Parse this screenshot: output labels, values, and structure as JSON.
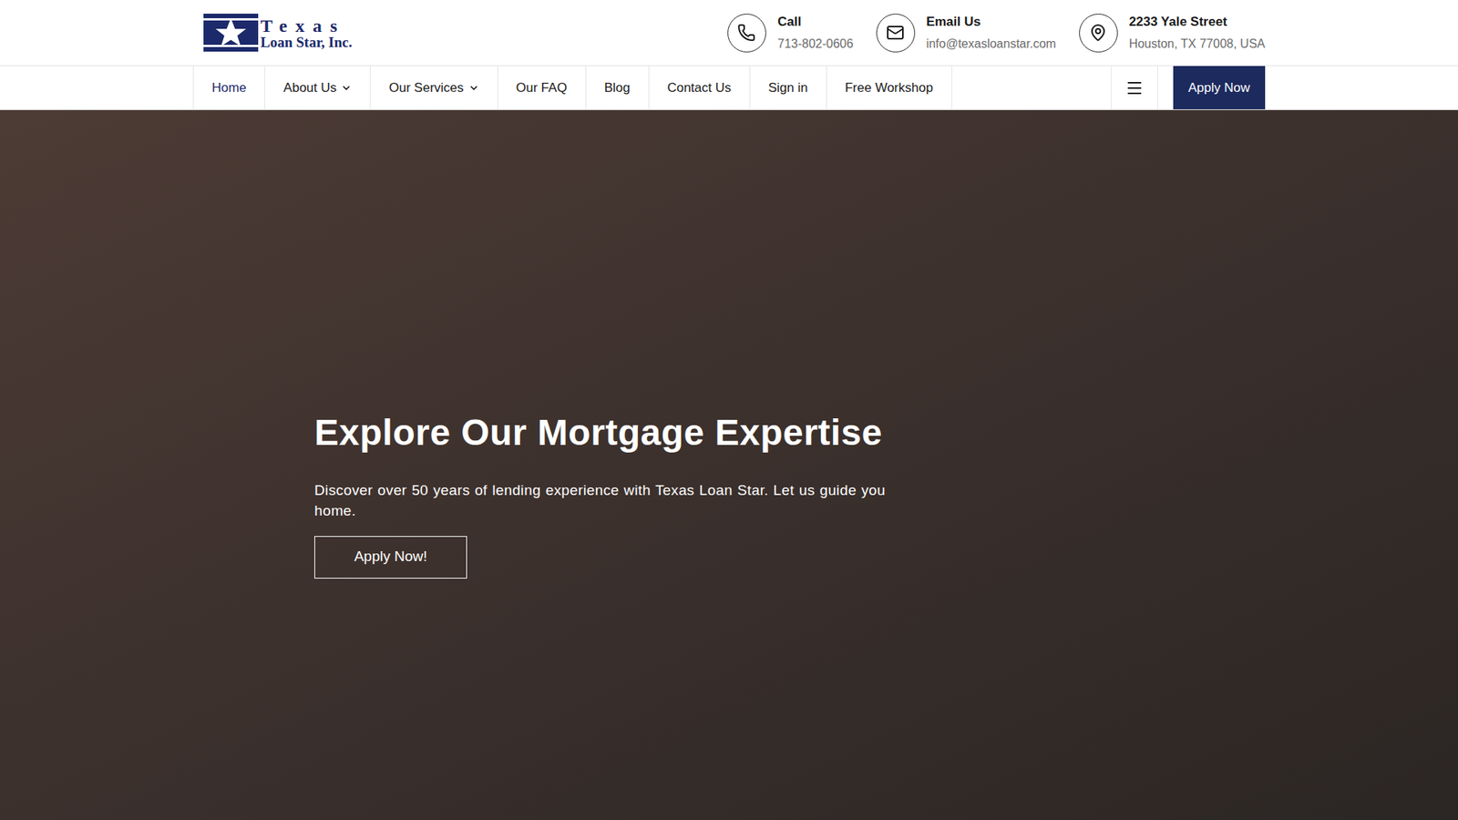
{
  "logo": {
    "line1": "Texas",
    "line2": "Loan Star, Inc."
  },
  "contacts": [
    {
      "kind": "phone",
      "label": "Call",
      "value": "713-802-0606"
    },
    {
      "kind": "email",
      "label": "Email Us",
      "value": "info@texasloanstar.com"
    },
    {
      "kind": "address",
      "label": "2233 Yale Street",
      "value": "Houston, TX 77008, USA"
    }
  ],
  "nav": [
    {
      "label": "Home",
      "selected": true,
      "dropdown": false
    },
    {
      "label": "About Us",
      "selected": false,
      "dropdown": true
    },
    {
      "label": "Our Services",
      "selected": false,
      "dropdown": true
    },
    {
      "label": "Our FAQ",
      "selected": false,
      "dropdown": false
    },
    {
      "label": "Blog",
      "selected": false,
      "dropdown": false
    },
    {
      "label": "Contact Us",
      "selected": false,
      "dropdown": false
    },
    {
      "label": "Sign in",
      "selected": false,
      "dropdown": false
    },
    {
      "label": "Free Workshop",
      "selected": false,
      "dropdown": false
    }
  ],
  "apply_button": "Apply Now",
  "hero": {
    "title": "Explore Our Mortgage Expertise",
    "text": "Discover over 50 years of lending experience with Texas Loan Star. Let us guide you home.",
    "button": "Apply Now!"
  }
}
